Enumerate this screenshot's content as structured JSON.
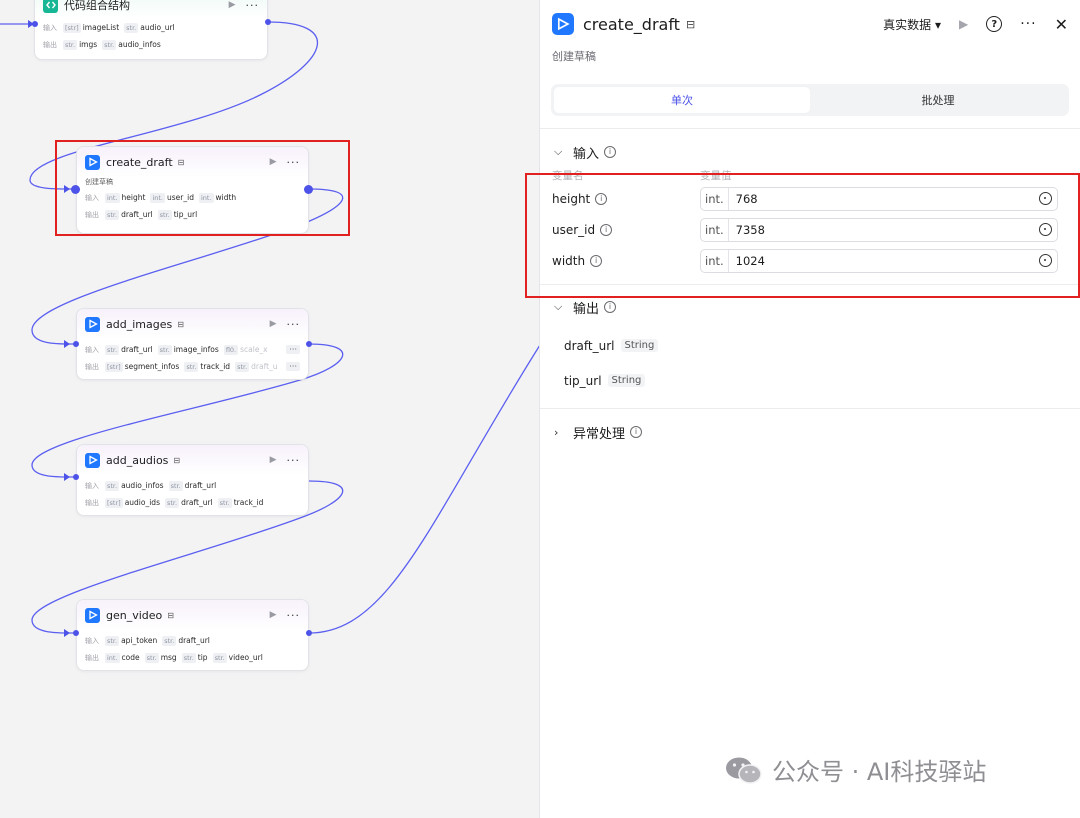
{
  "canvas": {
    "nodes": [
      {
        "title": "代码组合结构",
        "icon": "code-icon",
        "desc": "",
        "rows": [
          {
            "label": "输入",
            "chips": [
              {
                "t": "[str]",
                "v": "imageList"
              },
              {
                "t": "str.",
                "v": "audio_url"
              }
            ]
          },
          {
            "label": "输出",
            "chips": [
              {
                "t": "str.",
                "v": "imgs"
              },
              {
                "t": "str.",
                "v": "audio_infos"
              }
            ]
          }
        ]
      },
      {
        "title": "create_draft",
        "icon": "capcut-icon",
        "desc": "创建草稿",
        "rows": [
          {
            "label": "输入",
            "chips": [
              {
                "t": "int.",
                "v": "height"
              },
              {
                "t": "int.",
                "v": "user_id"
              },
              {
                "t": "int.",
                "v": "width"
              }
            ]
          },
          {
            "label": "输出",
            "chips": [
              {
                "t": "str.",
                "v": "draft_url"
              },
              {
                "t": "str.",
                "v": "tip_url"
              }
            ]
          }
        ]
      },
      {
        "title": "add_images",
        "icon": "capcut-icon",
        "desc": "",
        "rows": [
          {
            "label": "输入",
            "chips": [
              {
                "t": "str.",
                "v": "draft_url"
              },
              {
                "t": "str.",
                "v": "image_infos"
              },
              {
                "t": "fl0.",
                "v": "scale_x",
                "faded": true
              }
            ],
            "more": "···"
          },
          {
            "label": "输出",
            "chips": [
              {
                "t": "[str]",
                "v": "segment_infos"
              },
              {
                "t": "str.",
                "v": "track_id"
              },
              {
                "t": "str.",
                "v": "draft_u",
                "faded": true
              }
            ],
            "more": "···"
          }
        ]
      },
      {
        "title": "add_audios",
        "icon": "capcut-icon",
        "desc": "",
        "rows": [
          {
            "label": "输入",
            "chips": [
              {
                "t": "str.",
                "v": "audio_infos"
              },
              {
                "t": "str.",
                "v": "draft_url"
              }
            ]
          },
          {
            "label": "输出",
            "chips": [
              {
                "t": "[str]",
                "v": "audio_ids"
              },
              {
                "t": "str.",
                "v": "draft_url"
              },
              {
                "t": "str.",
                "v": "track_id"
              }
            ]
          }
        ]
      },
      {
        "title": "gen_video",
        "icon": "capcut-icon",
        "desc": "",
        "rows": [
          {
            "label": "输入",
            "chips": [
              {
                "t": "str.",
                "v": "api_token"
              },
              {
                "t": "str.",
                "v": "draft_url"
              }
            ]
          },
          {
            "label": "输出",
            "chips": [
              {
                "t": "int.",
                "v": "code"
              },
              {
                "t": "str.",
                "v": "msg"
              },
              {
                "t": "str.",
                "v": "tip"
              },
              {
                "t": "str.",
                "v": "video_url"
              }
            ]
          }
        ]
      }
    ]
  },
  "panel": {
    "title": "create_draft",
    "subtitle": "创建草稿",
    "data_mode": "真实数据 ▾",
    "tabs": [
      "单次",
      "批处理"
    ],
    "active_tab": 0,
    "input_section": "输入",
    "col_name": "变量名",
    "col_value": "变量值",
    "inputs": [
      {
        "name": "height",
        "type": "int.",
        "value": "768"
      },
      {
        "name": "user_id",
        "type": "int.",
        "value": "7358"
      },
      {
        "name": "width",
        "type": "int.",
        "value": "1024"
      }
    ],
    "output_section": "输出",
    "outputs": [
      {
        "name": "draft_url",
        "type": "String"
      },
      {
        "name": "tip_url",
        "type": "String"
      }
    ],
    "error_section": "异常处理"
  },
  "watermark": "公众号 · AI科技驿站",
  "colors": {
    "accent": "#4d53e8",
    "highlight": "#e0211f",
    "node_icon": "#1f78ff",
    "code_icon": "#17b796"
  }
}
